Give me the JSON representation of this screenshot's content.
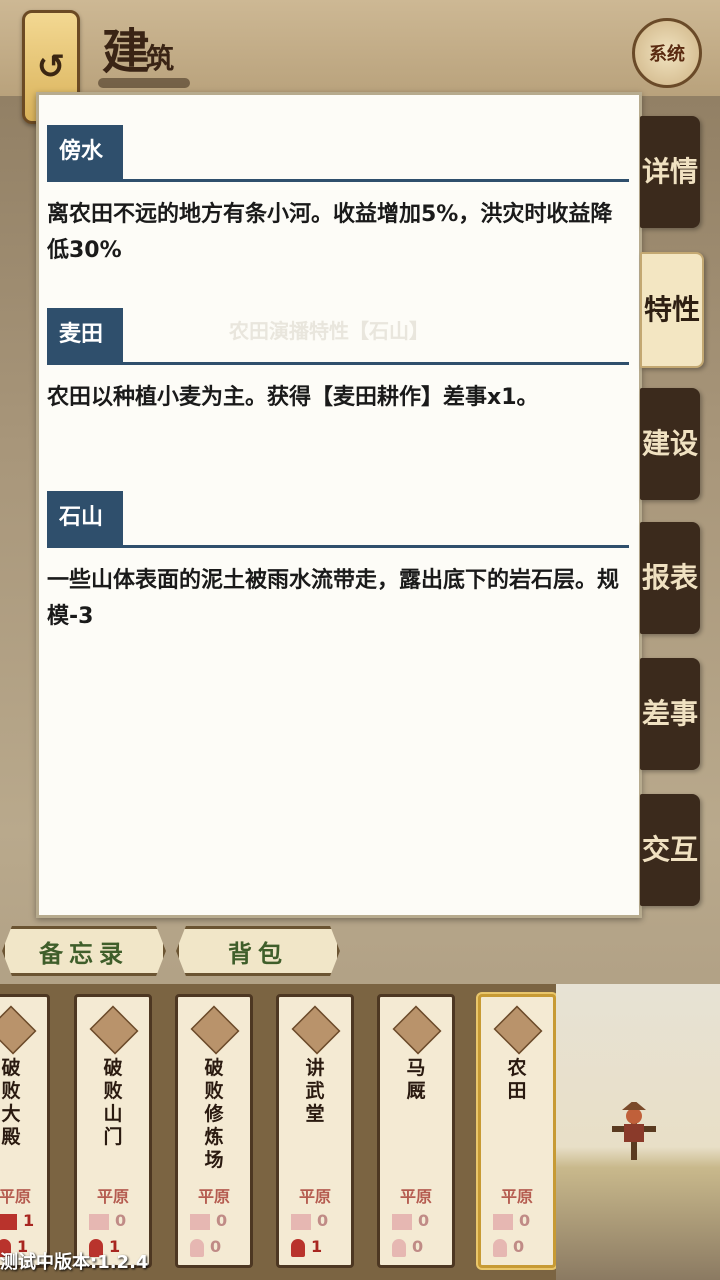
{
  "header": {
    "title_main": "建",
    "title_sub": "筑",
    "back_icon": "back-arrow-icon",
    "system_label": "系统"
  },
  "panel": {
    "ghost_text": "农田演播特性【石山】",
    "sections": [
      {
        "tag": "傍水",
        "text": "离农田不远的地方有条小河。收益增加5%，洪灾时收益降低30%"
      },
      {
        "tag": "麦田",
        "text": "农田以种植小麦为主。获得【麦田耕作】差事x1。"
      },
      {
        "tag": "石山",
        "text": "一些山体表面的泥土被雨水流带走，露出底下的岩石层。规模-3"
      }
    ]
  },
  "side_tabs": [
    "详情",
    "特性",
    "建设",
    "报表",
    "差事",
    "交互"
  ],
  "active_tab": "特性",
  "bottom_tabs": [
    "备忘录",
    "背包"
  ],
  "cards": [
    {
      "name": "破败大殿",
      "terrain": "平原",
      "stat1": "1",
      "stat2": "1"
    },
    {
      "name": "破败山门",
      "terrain": "平原",
      "stat1": "0",
      "stat2": "1"
    },
    {
      "name": "破败修炼场",
      "terrain": "平原",
      "stat1": "0",
      "stat2": "0"
    },
    {
      "name": "讲武堂",
      "terrain": "平原",
      "stat1": "0",
      "stat2": "1"
    },
    {
      "name": "马厩",
      "terrain": "平原",
      "stat1": "0",
      "stat2": "0"
    },
    {
      "name": "农田",
      "terrain": "平原",
      "stat1": "0",
      "stat2": "0"
    }
  ],
  "version": "测试中版本:1.2.4",
  "colors": {
    "tag_bg": "#2f4f6c",
    "tab_dark": "#3b2a1c",
    "tab_active": "#f3e6c2",
    "banner_text": "#3f5e2a"
  }
}
